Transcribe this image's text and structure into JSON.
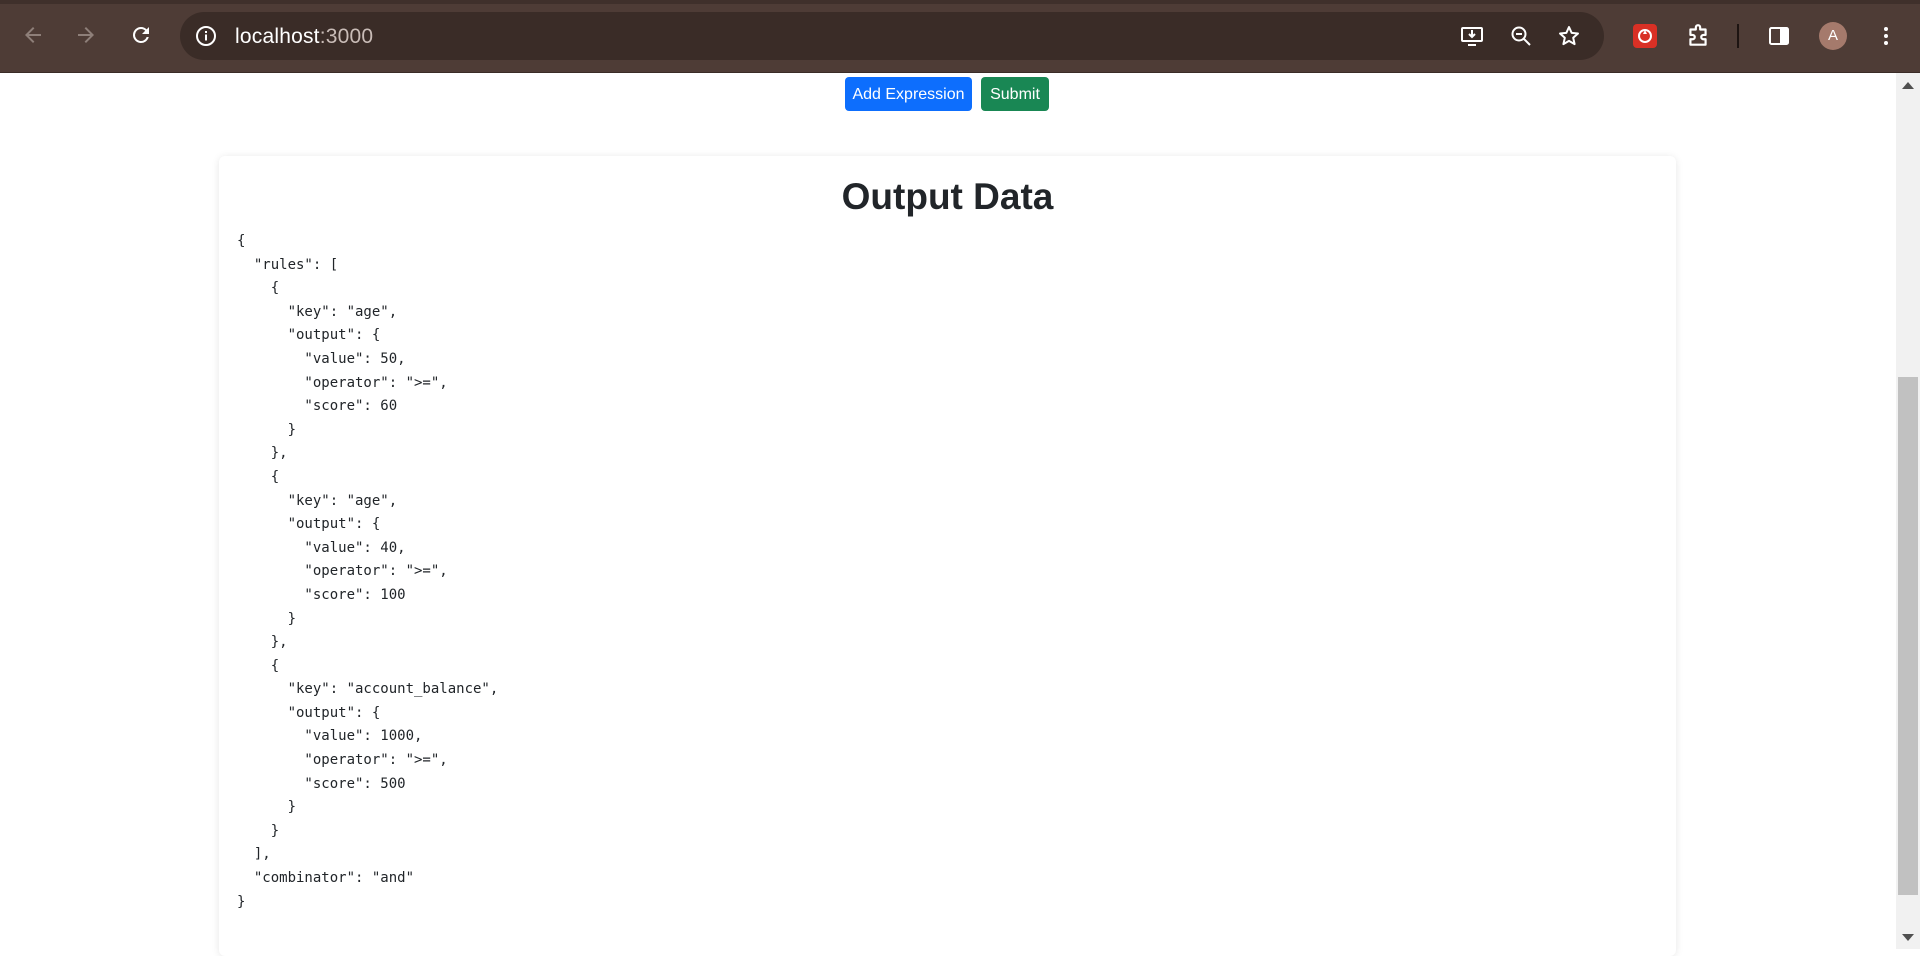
{
  "browser": {
    "url_host": "localhost",
    "url_port": ":3000",
    "profile_initial": "A",
    "icons": [
      "back-arrow-icon",
      "forward-arrow-icon",
      "reload-icon",
      "site-info-icon",
      "install-app-icon",
      "zoom-out-icon",
      "bookmark-star-icon",
      "extension-app-icon",
      "extensions-puzzle-icon",
      "side-panel-icon",
      "more-menu-icon"
    ]
  },
  "toolbar": {
    "add_expression_label": "Add Expression",
    "submit_label": "Submit"
  },
  "output": {
    "title": "Output Data",
    "json_text": "{\n  \"rules\": [\n    {\n      \"key\": \"age\",\n      \"output\": {\n        \"value\": 50,\n        \"operator\": \">=\",\n        \"score\": 60\n      }\n    },\n    {\n      \"key\": \"age\",\n      \"output\": {\n        \"value\": 40,\n        \"operator\": \">=\",\n        \"score\": 100\n      }\n    },\n    {\n      \"key\": \"account_balance\",\n      \"output\": {\n        \"value\": 1000,\n        \"operator\": \">=\",\n        \"score\": 500\n      }\n    }\n  ],\n  \"combinator\": \"and\"\n}"
  },
  "colors": {
    "chrome_bg": "#4e3c36",
    "omnibox_bg": "#3a2c27",
    "primary_button": "#0d6efd",
    "success_button": "#198754",
    "text": "#212529"
  }
}
